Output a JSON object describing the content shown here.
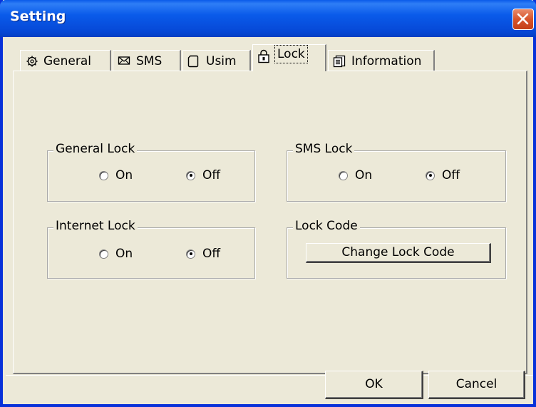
{
  "window": {
    "title": "Setting"
  },
  "tabs": [
    {
      "label": "General",
      "icon": "gear-icon"
    },
    {
      "label": "SMS",
      "icon": "envelope-icon"
    },
    {
      "label": "Usim",
      "icon": "sim-card-icon"
    },
    {
      "label": "Lock",
      "icon": "lock-icon",
      "active": true
    },
    {
      "label": "Information",
      "icon": "document-icon"
    }
  ],
  "groups": {
    "general_lock": {
      "title": "General Lock",
      "on_label": "On",
      "off_label": "Off",
      "selected": "Off"
    },
    "sms_lock": {
      "title": "SMS Lock",
      "on_label": "On",
      "off_label": "Off",
      "selected": "Off"
    },
    "internet_lock": {
      "title": "Internet Lock",
      "on_label": "On",
      "off_label": "Off",
      "selected": "Off"
    },
    "lock_code": {
      "title": "Lock Code",
      "button_label": "Change Lock Code"
    }
  },
  "footer": {
    "ok_label": "OK",
    "cancel_label": "Cancel"
  },
  "colors": {
    "titlebar": "#0a5bea",
    "close_button": "#d7542b",
    "dialog_face": "#ece9d8"
  }
}
